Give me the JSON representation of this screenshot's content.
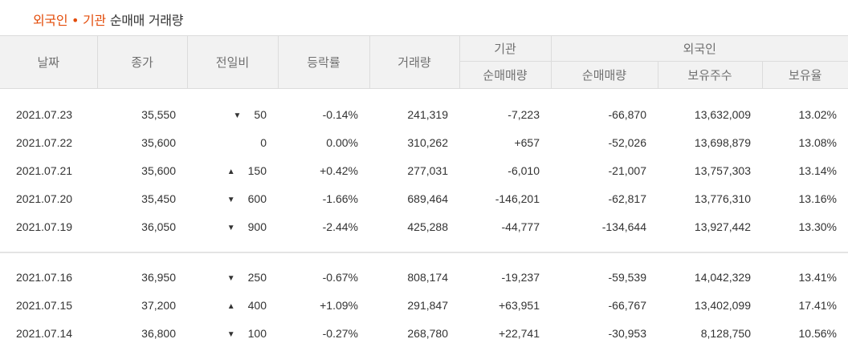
{
  "title": {
    "highlight": "외국인 • 기관",
    "rest": "순매매 거래량"
  },
  "headers": {
    "date": "날짜",
    "close": "종가",
    "change": "전일비",
    "rate": "등락률",
    "volume": "거래량",
    "institution": "기관",
    "foreign": "외국인",
    "inst_net": "순매매량",
    "foreign_net": "순매매량",
    "holdings": "보유주수",
    "holding_ratio": "보유율"
  },
  "colors": {
    "up": "#d60000",
    "down": "#1261c4",
    "title_accent": "#e34c0a"
  },
  "rows": [
    {
      "date": "2021.07.23",
      "close": "35,550",
      "dir": "down",
      "arrow": "▼",
      "change": "50",
      "rate": "-0.14%",
      "volume": "241,319",
      "inst": "-7,223",
      "inst_dir": "down",
      "foreign": "-66,870",
      "foreign_dir": "down",
      "holdings": "13,632,009",
      "ratio": "13.02%"
    },
    {
      "date": "2021.07.22",
      "close": "35,600",
      "dir": "flat",
      "arrow": "",
      "change": "0",
      "rate": "0.00%",
      "volume": "310,262",
      "inst": "+657",
      "inst_dir": "up",
      "foreign": "-52,026",
      "foreign_dir": "down",
      "holdings": "13,698,879",
      "ratio": "13.08%"
    },
    {
      "date": "2021.07.21",
      "close": "35,600",
      "dir": "up",
      "arrow": "▲",
      "change": "150",
      "rate": "+0.42%",
      "volume": "277,031",
      "inst": "-6,010",
      "inst_dir": "down",
      "foreign": "-21,007",
      "foreign_dir": "down",
      "holdings": "13,757,303",
      "ratio": "13.14%"
    },
    {
      "date": "2021.07.20",
      "close": "35,450",
      "dir": "down",
      "arrow": "▼",
      "change": "600",
      "rate": "-1.66%",
      "volume": "689,464",
      "inst": "-146,201",
      "inst_dir": "down",
      "foreign": "-62,817",
      "foreign_dir": "down",
      "holdings": "13,776,310",
      "ratio": "13.16%"
    },
    {
      "date": "2021.07.19",
      "close": "36,050",
      "dir": "down",
      "arrow": "▼",
      "change": "900",
      "rate": "-2.44%",
      "volume": "425,288",
      "inst": "-44,777",
      "inst_dir": "down",
      "foreign": "-134,644",
      "foreign_dir": "down",
      "holdings": "13,927,442",
      "ratio": "13.30%"
    },
    {
      "date": "2021.07.16",
      "close": "36,950",
      "dir": "down",
      "arrow": "▼",
      "change": "250",
      "rate": "-0.67%",
      "volume": "808,174",
      "inst": "-19,237",
      "inst_dir": "down",
      "foreign": "-59,539",
      "foreign_dir": "down",
      "holdings": "14,042,329",
      "ratio": "13.41%"
    },
    {
      "date": "2021.07.15",
      "close": "37,200",
      "dir": "up",
      "arrow": "▲",
      "change": "400",
      "rate": "+1.09%",
      "volume": "291,847",
      "inst": "+63,951",
      "inst_dir": "up",
      "foreign": "-66,767",
      "foreign_dir": "down",
      "holdings": "13,402,099",
      "ratio": "17.41%"
    },
    {
      "date": "2021.07.14",
      "close": "36,800",
      "dir": "down",
      "arrow": "▼",
      "change": "100",
      "rate": "-0.27%",
      "volume": "268,780",
      "inst": "+22,741",
      "inst_dir": "up",
      "foreign": "-30,953",
      "foreign_dir": "down",
      "holdings": "8,128,750",
      "ratio": "10.56%"
    }
  ]
}
